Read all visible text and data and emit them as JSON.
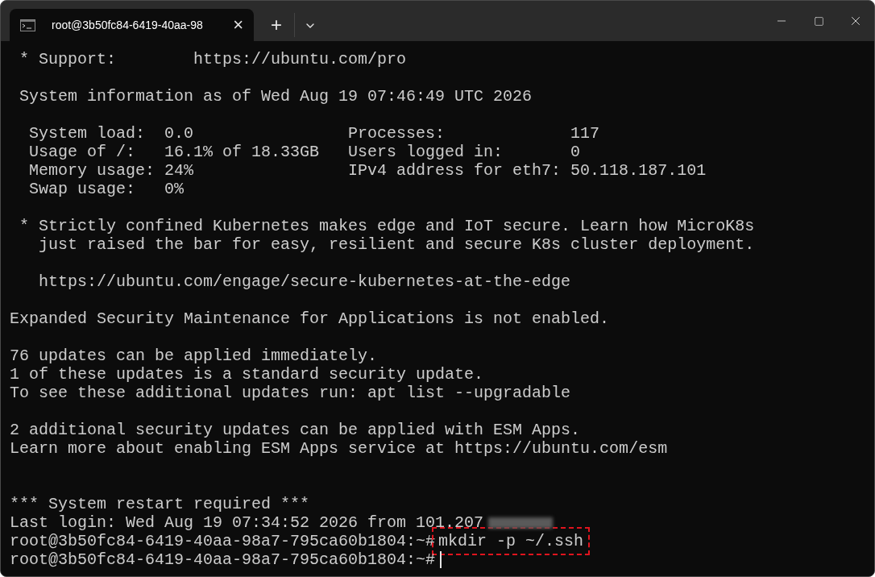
{
  "tab": {
    "title": "root@3b50fc84-6419-40aa-98",
    "selected": true,
    "close": "×"
  },
  "tab_actions": {
    "new_tab": "+"
  },
  "window_controls": [
    {
      "kind": "minimize"
    },
    {
      "kind": "maximize"
    },
    {
      "kind": "close"
    }
  ],
  "terminal": {
    "lines": [
      {
        "kind": "text",
        "text": " * Support:        https://ubuntu.com/pro"
      },
      {
        "kind": "blank"
      },
      {
        "kind": "text",
        "text": " System information as of Wed Aug 19 07:46:49 UTC 2026"
      },
      {
        "kind": "blank"
      },
      {
        "kind": "text",
        "text": "  System load:  0.0                Processes:             117"
      },
      {
        "kind": "text",
        "text": "  Usage of /:   16.1% of 18.33GB   Users logged in:       0"
      },
      {
        "kind": "text",
        "text": "  Memory usage: 24%                IPv4 address for eth7: 50.118.187.101"
      },
      {
        "kind": "text",
        "text": "  Swap usage:   0%"
      },
      {
        "kind": "blank"
      },
      {
        "kind": "text",
        "text": " * Strictly confined Kubernetes makes edge and IoT secure. Learn how MicroK8s"
      },
      {
        "kind": "text",
        "text": "   just raised the bar for easy, resilient and secure K8s cluster deployment."
      },
      {
        "kind": "blank"
      },
      {
        "kind": "text",
        "text": "   https://ubuntu.com/engage/secure-kubernetes-at-the-edge"
      },
      {
        "kind": "blank"
      },
      {
        "kind": "text",
        "text": "Expanded Security Maintenance for Applications is not enabled."
      },
      {
        "kind": "blank"
      },
      {
        "kind": "text",
        "text": "76 updates can be applied immediately."
      },
      {
        "kind": "text",
        "text": "1 of these updates is a standard security update."
      },
      {
        "kind": "text",
        "text": "To see these additional updates run: apt list --upgradable"
      },
      {
        "kind": "blank"
      },
      {
        "kind": "text",
        "text": "2 additional security updates can be applied with ESM Apps."
      },
      {
        "kind": "text",
        "text": "Learn more about enabling ESM Apps service at https://ubuntu.com/esm"
      },
      {
        "kind": "blank"
      },
      {
        "kind": "blank"
      },
      {
        "kind": "text",
        "text": "*** System restart required ***"
      },
      {
        "kind": "text",
        "text": "Last login: Wed Aug 19 07:34:52 2026 from 101.207",
        "redacted": true
      },
      {
        "kind": "prompt",
        "prompt": "root@3b50fc84-6419-40aa-98a7-795ca60b1804:~#",
        "command": "mkdir -p ~/.ssh",
        "highlighted": true
      },
      {
        "kind": "prompt",
        "prompt": "root@3b50fc84-6419-40aa-98a7-795ca60b1804:~#",
        "cursor": true
      }
    ]
  }
}
